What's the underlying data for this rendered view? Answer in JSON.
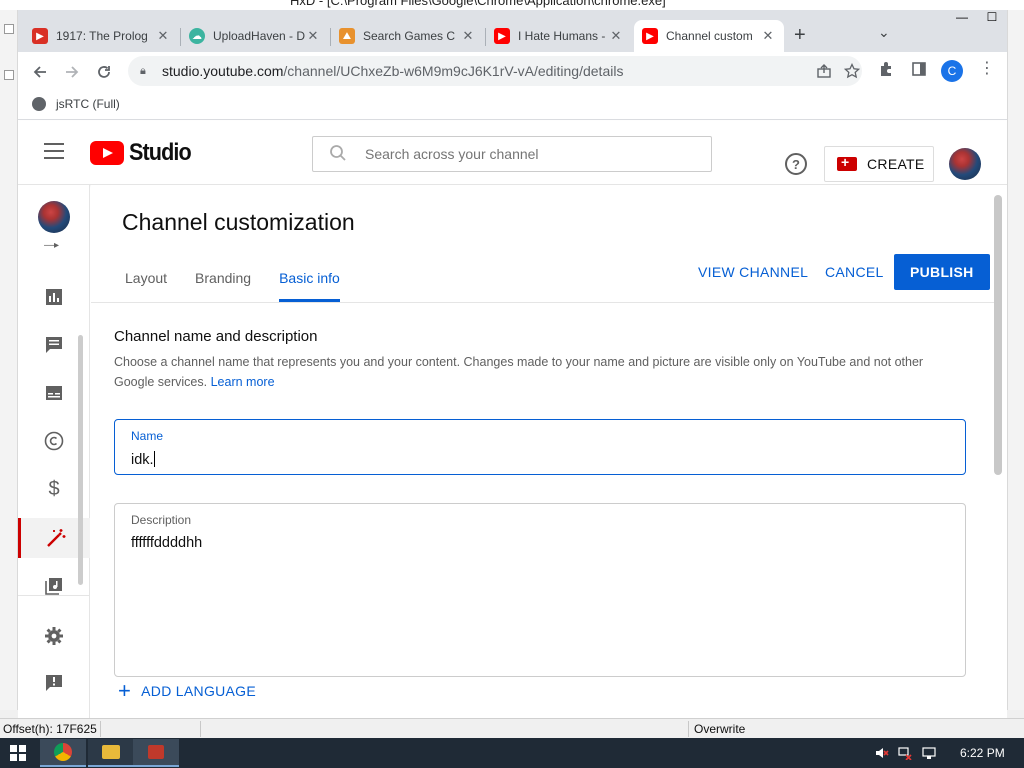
{
  "window_title": "HxD - [C:\\Program Files\\Google\\Chrome\\Application\\chrome.exe]",
  "status_bar": {
    "offset": "Offset(h): 17F625",
    "mode": "Overwrite"
  },
  "browser": {
    "tabs": [
      {
        "title": "1917: The Prolog",
        "favicon_color": "#d93025"
      },
      {
        "title": "UploadHaven - D",
        "favicon_color": "#3cb4a0"
      },
      {
        "title": "Search Games C",
        "favicon_color": "#e8912d"
      },
      {
        "title": "I Hate Humans -",
        "favicon_color": "#ff0000"
      },
      {
        "title": "Channel custom",
        "favicon_color": "#ff0000"
      }
    ],
    "url_host": "studio.youtube.com",
    "url_path": "/channel/UChxeZb-w6M9m9cJ6K1rV-vA/editing/details",
    "profile_initial": "C",
    "bookmark": "jsRTC (Full)"
  },
  "studio": {
    "logo_text": "Studio",
    "search_placeholder": "Search across your channel",
    "help_icon": "?",
    "create_label": "CREATE",
    "page_title": "Channel customization",
    "tabs": [
      "Layout",
      "Branding",
      "Basic info"
    ],
    "active_tab": "Basic info",
    "actions": {
      "view_channel": "VIEW CHANNEL",
      "cancel": "CANCEL",
      "publish": "PUBLISH"
    },
    "section": {
      "title": "Channel name and description",
      "description": "Choose a channel name that represents you and your content. Changes made to your name and picture are visible only on YouTube and not other Google services.",
      "learn_more": "Learn more"
    },
    "name_field": {
      "label": "Name",
      "value": "idk."
    },
    "description_field": {
      "label": "Description",
      "value": "ffffffddddhh"
    },
    "add_language": "ADD LANGUAGE"
  },
  "taskbar": {
    "time": "6:22 PM"
  },
  "colors": {
    "accent_blue": "#065fd4",
    "youtube_red": "#ff0000",
    "studio_red": "#cc0000"
  }
}
